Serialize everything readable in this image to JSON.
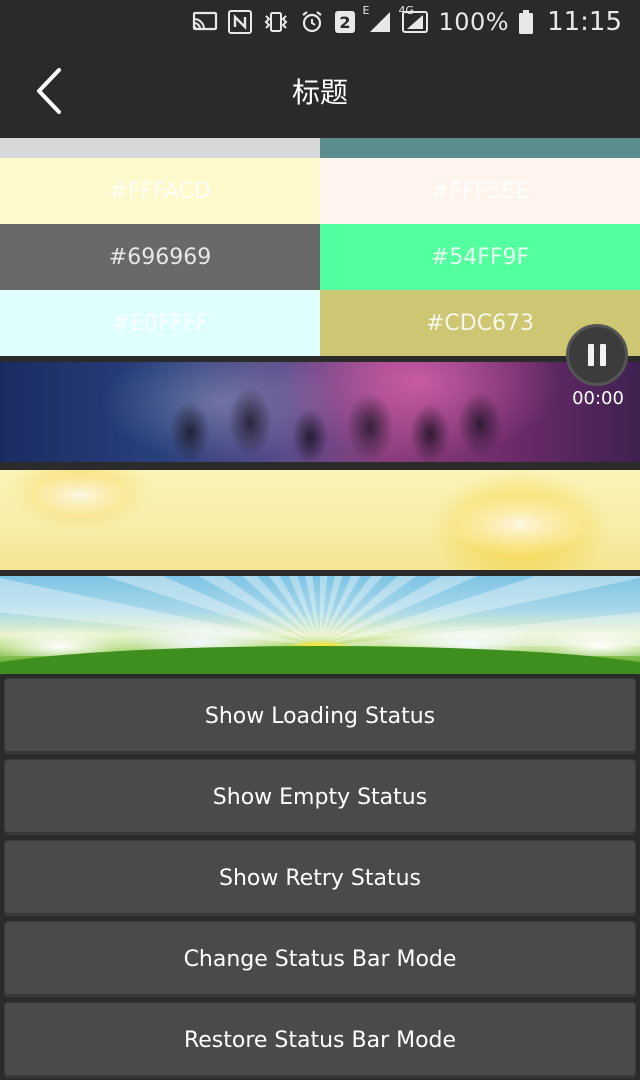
{
  "status_bar": {
    "battery": "100%",
    "time": "11:15",
    "sim_badge": "2",
    "network_small": "E",
    "network_4g": "4G",
    "icons": [
      "cast-icon",
      "nfc-icon",
      "vibrate-icon",
      "alarm-icon",
      "sim2-icon",
      "signal-icon",
      "signal-4g-icon",
      "battery-icon"
    ]
  },
  "title_bar": {
    "title": "标题",
    "back_icon": "chevron-left-icon"
  },
  "color_grid": {
    "top_strip_colors": [
      "#d8d8d8",
      "#5d8e8e"
    ],
    "cells": [
      {
        "label": "#FFFACD",
        "color": "#FFFACD"
      },
      {
        "label": "#FFF5EE",
        "color": "#FFF5EE"
      },
      {
        "label": "#696969",
        "color": "#696969"
      },
      {
        "label": "#54FF9F",
        "color": "#54FF9F"
      },
      {
        "label": "#E0FFFF",
        "color": "#E0FFFF"
      },
      {
        "label": "#CDC673",
        "color": "#CDC673"
      }
    ]
  },
  "media": {
    "time": "00:00",
    "state_icon": "pause-icon"
  },
  "buttons": [
    {
      "label": "Show Loading Status"
    },
    {
      "label": "Show Empty Status"
    },
    {
      "label": "Show Retry Status"
    },
    {
      "label": "Change Status Bar Mode"
    },
    {
      "label": "Restore Status Bar Mode"
    }
  ]
}
